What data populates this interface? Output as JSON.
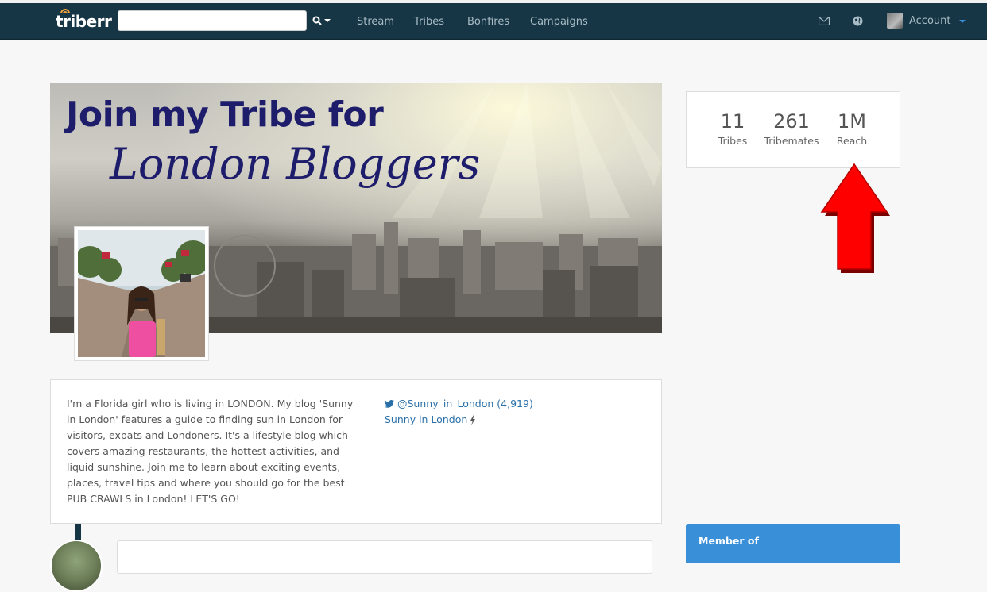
{
  "navbar": {
    "brand": "triberr",
    "search_placeholder": "",
    "links": [
      "Stream",
      "Tribes",
      "Bonfires",
      "Campaigns"
    ],
    "account_label": "Account",
    "icons": [
      "envelope-icon",
      "globe-icon"
    ]
  },
  "banner": {
    "line1": "Join my Tribe for",
    "line2": "London Bloggers"
  },
  "bio": {
    "text": "I'm a Florida girl who is living in LONDON. My blog 'Sunny in London' features a guide to finding sun in London for visitors, expats and Londoners. It's a lifestyle blog which covers amazing restaurants, the hottest activities, and liquid sunshine. Join me to learn about exciting events, places, travel tips and where you should go for the best PUB CRAWLS in London! LET'S GO!",
    "twitter_link": "@Sunny_in_London (4,919)",
    "blog_link": "Sunny in London"
  },
  "stats": [
    {
      "value": "11",
      "label": "Tribes"
    },
    {
      "value": "261",
      "label": "Tribemates"
    },
    {
      "value": "1M",
      "label": "Reach"
    }
  ],
  "sidebar": {
    "member_of": "Member of"
  },
  "colors": {
    "navbar": "#163645",
    "accent": "#3a8fd9",
    "banner_text": "#1e1d6b",
    "link": "#2a6fa8",
    "arrow": "#ff0000"
  }
}
